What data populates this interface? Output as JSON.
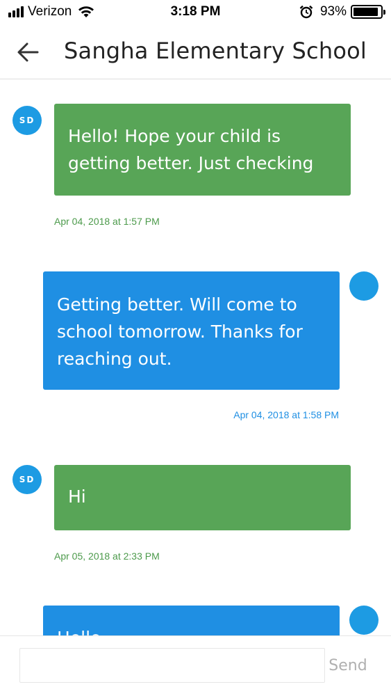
{
  "status_bar": {
    "carrier": "Verizon",
    "time": "3:18 PM",
    "battery_percent": "93%",
    "battery_level": 0.93,
    "icons": [
      "signal-icon",
      "wifi-icon",
      "alarm-icon",
      "battery-icon"
    ]
  },
  "header": {
    "back_icon": "arrow-left-icon",
    "title": "Sangha Elementary School"
  },
  "messages": [
    {
      "direction": "incoming",
      "avatar_initials": "SD",
      "lines": [
        "Hello! Hope your child is",
        "getting better. Just checking"
      ],
      "timestamp": "Apr 04, 2018 at 1:57 PM"
    },
    {
      "direction": "outgoing",
      "avatar_initials": "",
      "lines": [
        "Getting better. Will come to",
        "school tomorrow. Thanks for",
        "reaching out."
      ],
      "timestamp": "Apr 04, 2018 at 1:58 PM"
    },
    {
      "direction": "incoming",
      "avatar_initials": "SD",
      "lines": [
        "Hi"
      ],
      "timestamp": "Apr 05, 2018 at 2:33 PM"
    },
    {
      "direction": "outgoing",
      "avatar_initials": "",
      "lines": [
        "Hello"
      ],
      "timestamp": ""
    }
  ],
  "composer": {
    "input_value": "",
    "input_placeholder": "",
    "send_label": "Send"
  },
  "colors": {
    "incoming_bubble": "#58a557",
    "outgoing_bubble": "#1f8fe3",
    "avatar": "#1d9be3",
    "incoming_timestamp": "#4c9a4b",
    "outgoing_timestamp": "#1f8fe3",
    "send_disabled": "#b0b0b0"
  }
}
